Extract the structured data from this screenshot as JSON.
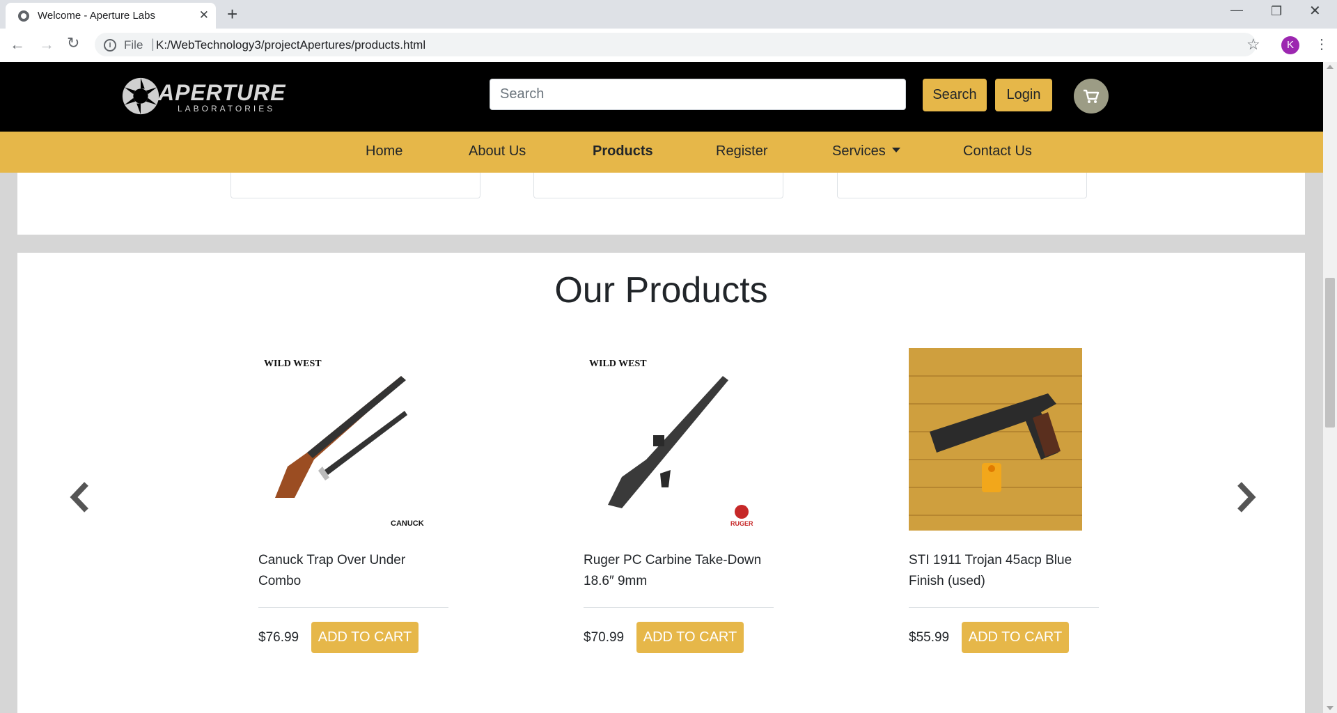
{
  "browser": {
    "tab_title": "Welcome - Aperture Labs",
    "omnibox_scheme": "File",
    "url": "K:/WebTechnology3/projectApertures/products.html",
    "profile_initial": "K"
  },
  "header": {
    "logo_word": "APERTURE",
    "logo_sub": "LABORATORIES",
    "search_placeholder": "Search",
    "search_button": "Search",
    "login_button": "Login"
  },
  "nav": {
    "items": [
      "Home",
      "About Us",
      "Products",
      "Register",
      "Services",
      "Contact Us"
    ],
    "active": "Products"
  },
  "products": {
    "title": "Our Products",
    "items": [
      {
        "name": "Canuck Trap Over Under Combo",
        "price": "$76.99",
        "button": "ADD TO CART",
        "badge_top": "WILD WEST",
        "badge_bottom": "CANUCK"
      },
      {
        "name": "Ruger PC Carbine Take-Down 18.6″ 9mm",
        "price": "$70.99",
        "button": "ADD TO CART",
        "badge_top": "WILD WEST",
        "badge_bottom": "RUGER"
      },
      {
        "name": "STI 1911 Trojan 45acp Blue Finish (used)",
        "price": "$55.99",
        "button": "ADD TO CART"
      }
    ]
  },
  "colors": {
    "brand_gold": "#e6b749",
    "header_black": "#000000",
    "page_gray": "#d6d6d6"
  }
}
